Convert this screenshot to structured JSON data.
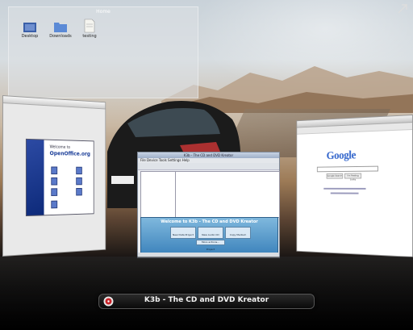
{
  "home_window": {
    "title": "Home",
    "icons": [
      {
        "label": "Desktop",
        "icon": "desktop-folder-icon"
      },
      {
        "label": "Downloads",
        "icon": "downloads-folder-icon"
      },
      {
        "label": "testing",
        "icon": "document-icon"
      }
    ]
  },
  "openoffice_window": {
    "welcome": "Welcome to",
    "brand": "OpenOffice.org"
  },
  "k3b_window": {
    "title": "K3b - The CD and DVD Kreator",
    "menu": "File  Device  Tools  Settings  Help",
    "banner": "Welcome to K3b - The CD and DVD Kreator",
    "buttons": [
      "New Data Project",
      "New Audio CD Project",
      "Copy Medium"
    ],
    "more": "More actions..."
  },
  "browser_window": {
    "logo": "Google",
    "search_label": "Google Search",
    "lucky_label": "I'm Feeling Lucky"
  },
  "caption": {
    "text": "K3b - The CD and DVD Kreator"
  },
  "colors": {
    "caption_bg": "#111111",
    "k3b_panel": "#3f85bd",
    "google_blue": "#3366cc",
    "google_red": "#d52b1e",
    "google_yellow": "#f5b400",
    "google_green": "#22a43a"
  }
}
